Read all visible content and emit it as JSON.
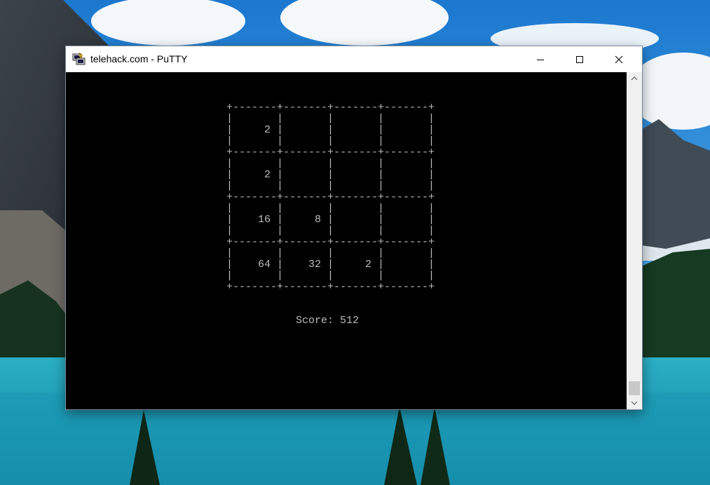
{
  "window": {
    "title": "telehack.com - PuTTY",
    "controls": {
      "minimize": "minimize-icon",
      "maximize": "maximize-icon",
      "close": "close-icon"
    }
  },
  "terminal": {
    "fg_color": "#bbbbbb",
    "bg_color": "#000000",
    "lines": [
      "+-------+-------+-------+-------+",
      "|       |       |       |       |",
      "|     2 |       |       |       |",
      "|       |       |       |       |",
      "+-------+-------+-------+-------+",
      "|       |       |       |       |",
      "|     2 |       |       |       |",
      "|       |       |       |       |",
      "+-------+-------+-------+-------+",
      "|       |       |       |       |",
      "|    16 |     8 |       |       |",
      "|       |       |       |       |",
      "+-------+-------+-------+-------+",
      "|       |       |       |       |",
      "|    64 |    32 |     2 |       |",
      "|       |       |       |       |",
      "+-------+-------+-------+-------+",
      "",
      "",
      "           Score: 512"
    ]
  },
  "game": {
    "board": [
      [
        2,
        null,
        null,
        null
      ],
      [
        2,
        null,
        null,
        null
      ],
      [
        16,
        8,
        null,
        null
      ],
      [
        64,
        32,
        2,
        null
      ]
    ],
    "score": 512
  },
  "scrollbar": {
    "up_icon": "chevron-up-icon",
    "down_icon": "chevron-down-icon",
    "position": "bottom"
  }
}
